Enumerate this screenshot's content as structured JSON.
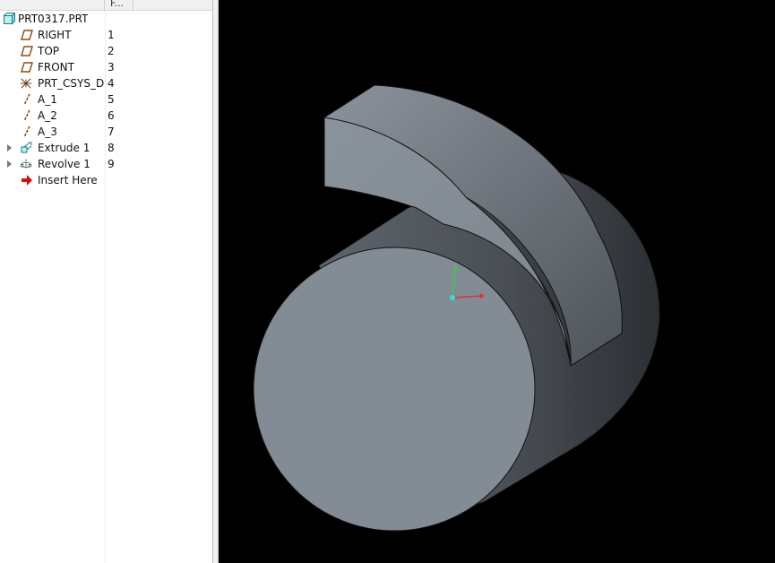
{
  "tree": {
    "header": {
      "feature_col": "F..."
    },
    "root": {
      "label": "PRT0317.PRT",
      "icon": "part-icon"
    },
    "items": [
      {
        "label": "RIGHT",
        "num": "1",
        "icon": "datum-plane-icon",
        "expandable": false
      },
      {
        "label": "TOP",
        "num": "2",
        "icon": "datum-plane-icon",
        "expandable": false
      },
      {
        "label": "FRONT",
        "num": "3",
        "icon": "datum-plane-icon",
        "expandable": false
      },
      {
        "label": "PRT_CSYS_D",
        "num": "4",
        "icon": "csys-icon",
        "expandable": false
      },
      {
        "label": "A_1",
        "num": "5",
        "icon": "datum-axis-icon",
        "expandable": false
      },
      {
        "label": "A_2",
        "num": "6",
        "icon": "datum-axis-icon",
        "expandable": false
      },
      {
        "label": "A_3",
        "num": "7",
        "icon": "datum-axis-icon",
        "expandable": false
      },
      {
        "label": "Extrude 1",
        "num": "8",
        "icon": "extrude-icon",
        "expandable": true
      },
      {
        "label": "Revolve 1",
        "num": "9",
        "icon": "revolve-icon",
        "expandable": true
      },
      {
        "label": "Insert Here",
        "num": "",
        "icon": "insert-arrow-icon",
        "expandable": false
      }
    ]
  },
  "viewport": {
    "background": "#000000",
    "model_colors": {
      "face_light": "#838b95",
      "face_mid": "#6f7780",
      "face_dark": "#3e4247",
      "edge": "#111111"
    },
    "triad_colors": {
      "x": "#e03030",
      "y": "#30d040",
      "origin": "#30e0e0"
    }
  }
}
